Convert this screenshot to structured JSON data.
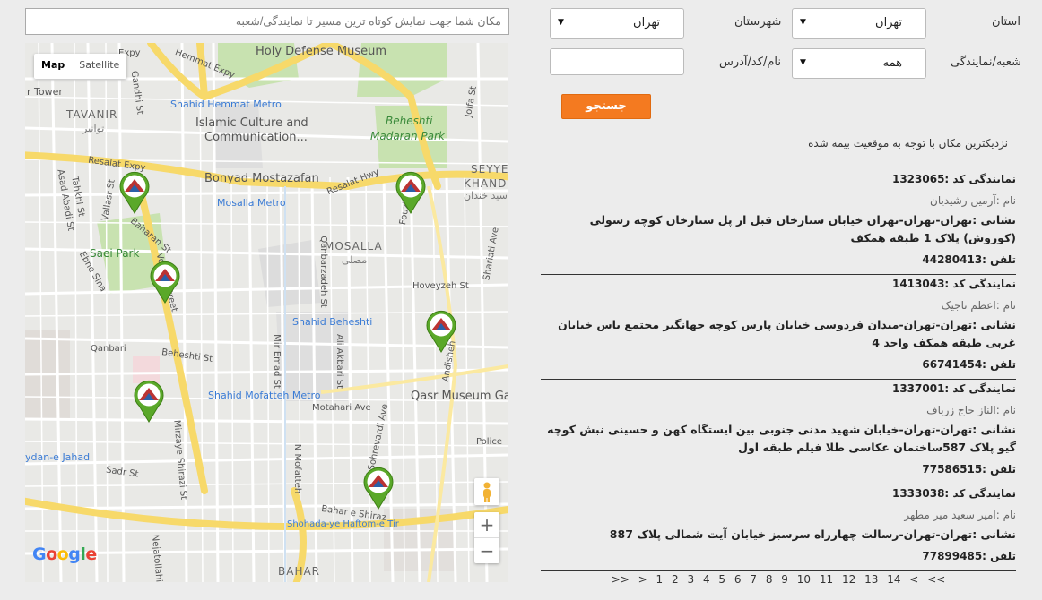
{
  "form": {
    "province_label": "استان",
    "province_value": "تهران",
    "city_label": "شهرستان",
    "city_value": "تهران",
    "branch_label": "شعبه/نمایندگی",
    "branch_value": "همه",
    "name_label": "نام/کد/آدرس",
    "name_value": "",
    "search_button": "جستجو"
  },
  "nearest_note": "نزدیکترین مکان با توجه به موقعیت بیمه شده",
  "results": [
    {
      "code": "نمایندگی کد :1323065",
      "name": "نام :آرمین رشیدیان",
      "address": "نشانی :تهران-تهران-تهران خیابان ستارخان قبل از پل ستارخان کوچه رسولی (کوروش) پلاک 1 طبقه همکف",
      "phone": "تلفن :44280413"
    },
    {
      "code": "نمایندگی کد :1413043",
      "name": "نام :اعظم تاجیک",
      "address": "نشانی :تهران-تهران-میدان فردوسی خیابان پارس کوچه جهانگیر مجتمع یاس خیابان غربی طبقه همکف واحد 4",
      "phone": "تلفن :66741454"
    },
    {
      "code": "نمایندگی کد :1337001",
      "name": "نام :الناز حاج زرباف",
      "address": "نشانی :تهران-تهران-خیابان شهید مدنی جنوبی بین ایستگاه کهن و حسینی نبش کوچه گیو پلاک 587ساختمان عکاسی طلا فیلم طبقه اول",
      "phone": "تلفن :77586515"
    },
    {
      "code": "نمایندگی کد :1333038",
      "name": "نام :امیر سعید میر مطهر",
      "address": "نشانی :تهران-تهران-رسالت چهارراه سرسبز خیابان آیت شمالی پلاک 887",
      "phone": "تلفن :77899485"
    }
  ],
  "pagination": [
    ">>",
    ">",
    "1",
    "2",
    "3",
    "4",
    "5",
    "6",
    "7",
    "8",
    "9",
    "10",
    "11",
    "12",
    "13",
    "14",
    "<",
    "<<"
  ],
  "map": {
    "origin_placeholder": "مکان شما جهت نمایش کوتاه ترین مسیر تا نمایندگی/شعبه",
    "map_type": [
      "Map",
      "Satellite"
    ],
    "zoom_in": "+",
    "zoom_out": "−",
    "google": "Google",
    "labels": [
      "Holy Defense Museum",
      "Hemmat Expy",
      "Expy",
      "r Tower",
      "TAVANIR",
      "توانیر",
      "Shahid Hemmat Metro",
      "Islamic Culture and",
      "Communication...",
      "Beheshti",
      "Madaran Park",
      "Resalat Expy",
      "Bonyad Mostazafan",
      "Resalat Hwy",
      "SEYYE",
      "KHAND",
      "سید خندان",
      "Mosalla Metro",
      "MOSALLA",
      "مصلی",
      "Saei Park",
      "Hoveyzeh St",
      "Shahid Beheshti",
      "Beheshti St",
      "Shahid Mofatteh Metro",
      "Qasr Museum Ga",
      "Motahari Ave",
      "ydan-e Jahad",
      "Police",
      "Shohada-ye Haftom-e Tir",
      "BAHAR",
      "Vozara Street",
      "Baharan St",
      "Gandhi St",
      "Vallasr St",
      "Asad Abadi St",
      "Tahkhi St",
      "Ebne Sina",
      "Qanbari",
      "Sadr St",
      "Mirzaye Shirazi St",
      "Nejatollahi",
      "Mir Emad St",
      "Ali Akbari St",
      "N Sohrevardi Ave",
      "N Mofatteh",
      "Qanbarzadeh St",
      "Andisheh",
      "Bahar e Shiraz",
      "Fouzieh St",
      "Jolfa St",
      "Shariati Ave"
    ]
  }
}
